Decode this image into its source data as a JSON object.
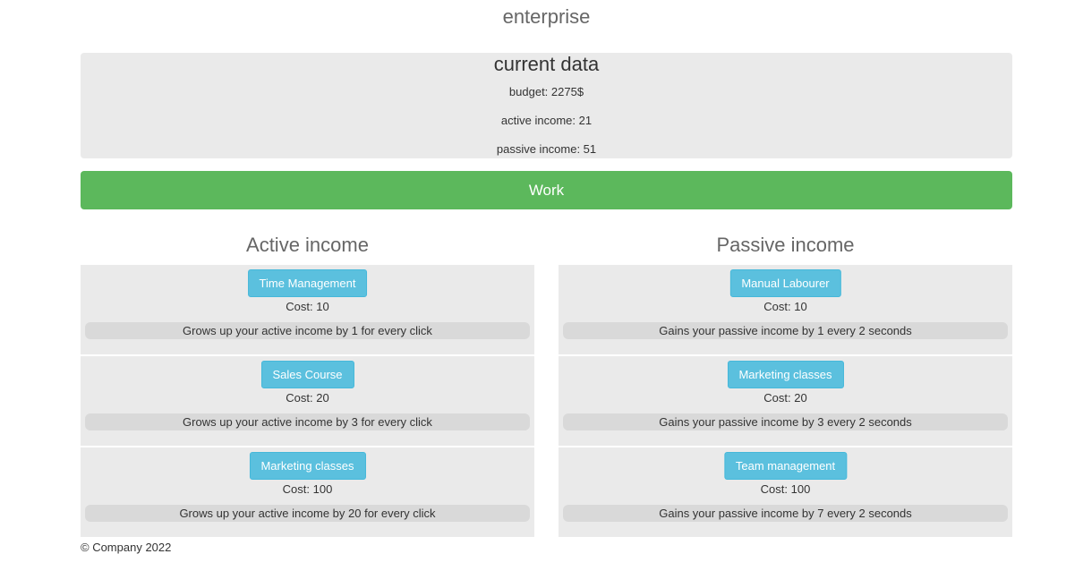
{
  "app": {
    "title": "enterprise"
  },
  "current": {
    "title": "current data",
    "budget": "budget: 2275$",
    "active_income": "active income: 21",
    "passive_income": "passive income: 51"
  },
  "work_button": "Work",
  "active": {
    "heading": "Active income",
    "items": [
      {
        "label": "Time Management",
        "cost": "Cost: 10",
        "desc": "Grows up your active income by 1 for every click"
      },
      {
        "label": "Sales Course",
        "cost": "Cost: 20",
        "desc": "Grows up your active income by 3 for every click"
      },
      {
        "label": "Marketing classes",
        "cost": "Cost: 100",
        "desc": "Grows up your active income by 20 for every click"
      }
    ]
  },
  "passive": {
    "heading": "Passive income",
    "items": [
      {
        "label": "Manual Labourer",
        "cost": "Cost: 10",
        "desc": "Gains your passive income by 1 every 2 seconds"
      },
      {
        "label": "Marketing classes",
        "cost": "Cost: 20",
        "desc": "Gains your passive income by 3 every 2 seconds"
      },
      {
        "label": "Team management",
        "cost": "Cost: 100",
        "desc": "Gains your passive income by 7 every 2 seconds"
      }
    ]
  },
  "footer": "© Company 2022",
  "colors": {
    "work_button": "#5cb85c",
    "upgrade_button": "#5bc0de",
    "panel_bg": "#eaeaea",
    "desc_bg": "#d9d9d9"
  }
}
